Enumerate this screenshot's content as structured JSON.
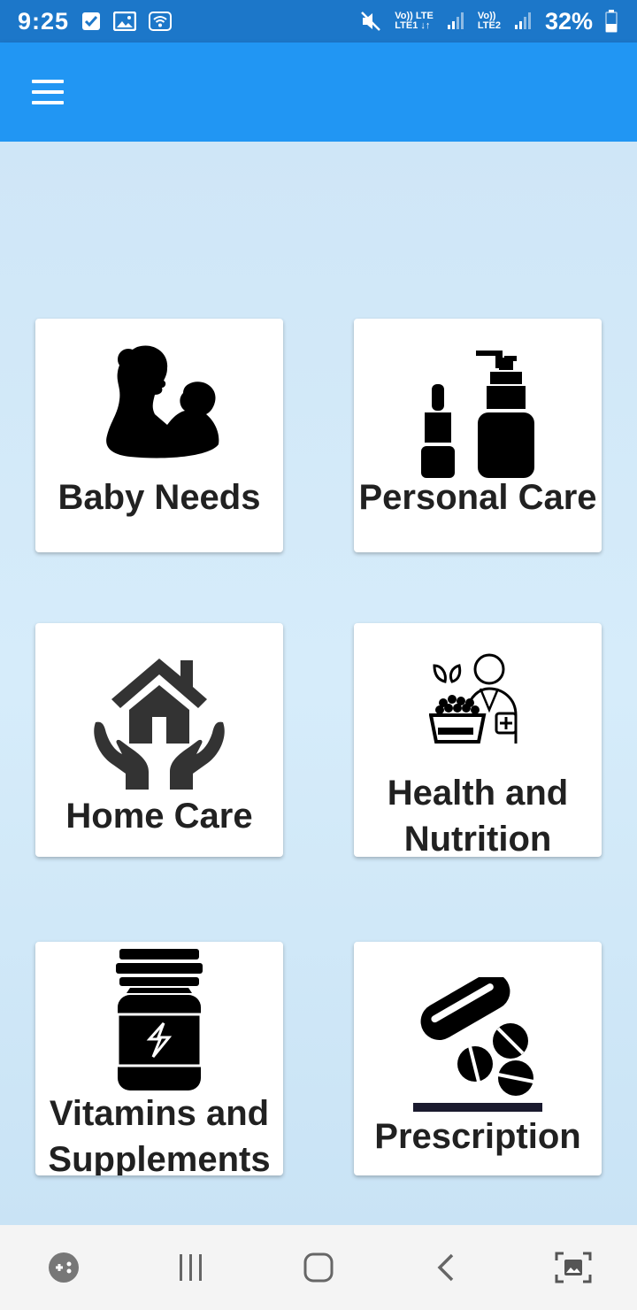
{
  "status_bar": {
    "time": "9:25",
    "net1_top": "Vo)) LTE",
    "net1_bottom": "LTE1 ↓↑",
    "net2_top": "Vo))",
    "net2_bottom": "LTE2",
    "battery": "32%",
    "icons": [
      "check-icon",
      "image-icon",
      "wifi-icon",
      "mute-icon",
      "signal-icon",
      "battery-icon"
    ]
  },
  "app_bar": {
    "menu_icon": "hamburger-menu-icon"
  },
  "categories": [
    {
      "label": "Baby Needs",
      "icon": "mother-baby-icon"
    },
    {
      "label": "Personal Care",
      "icon": "cosmetic-bottles-icon"
    },
    {
      "label": "Home Care",
      "icon": "house-hands-icon"
    },
    {
      "label": "Health and\nNutrition",
      "icon": "nutritionist-icon"
    },
    {
      "label": "Vitamins and\nSupplements",
      "icon": "supplement-jar-icon"
    },
    {
      "label": "Prescription",
      "icon": "pills-icon"
    }
  ],
  "nav_bar": {
    "icons": [
      "game-tools-icon",
      "recents-icon",
      "home-icon",
      "back-icon",
      "screenshot-icon"
    ]
  },
  "colors": {
    "status_bar": "#1c77c9",
    "app_bar": "#2196f3",
    "background": "#cfe6f6",
    "card": "#ffffff",
    "label": "#212121"
  }
}
